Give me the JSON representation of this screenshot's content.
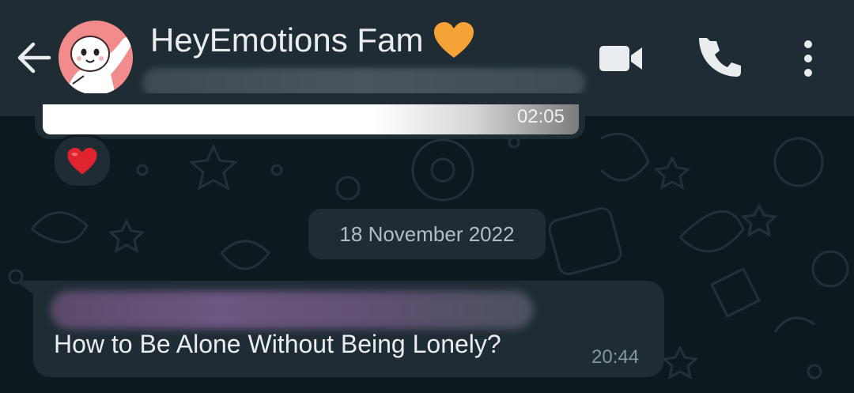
{
  "header": {
    "back_icon": "arrow-left-icon",
    "title": "HeyEmotions Fam",
    "title_emoji": "orange-heart-icon",
    "actions": [
      {
        "icon": "video-camera-icon"
      },
      {
        "icon": "phone-icon"
      },
      {
        "icon": "more-vertical-icon"
      }
    ]
  },
  "previous_message": {
    "time": "02:05",
    "reaction": "red-heart-icon"
  },
  "date_separator": "18 November 2022",
  "message": {
    "text": "How to Be Alone Without Being Lonely?",
    "time": "20:44"
  },
  "colors": {
    "header_bg": "#1f2c34",
    "chat_bg": "#0e181f",
    "bubble_bg": "#1f2c34",
    "text_primary": "#e9edef",
    "text_secondary": "#8696a0",
    "avatar_bg": "#f28b8b",
    "heart_orange": "#f5a336",
    "heart_red": "#e0242f"
  }
}
